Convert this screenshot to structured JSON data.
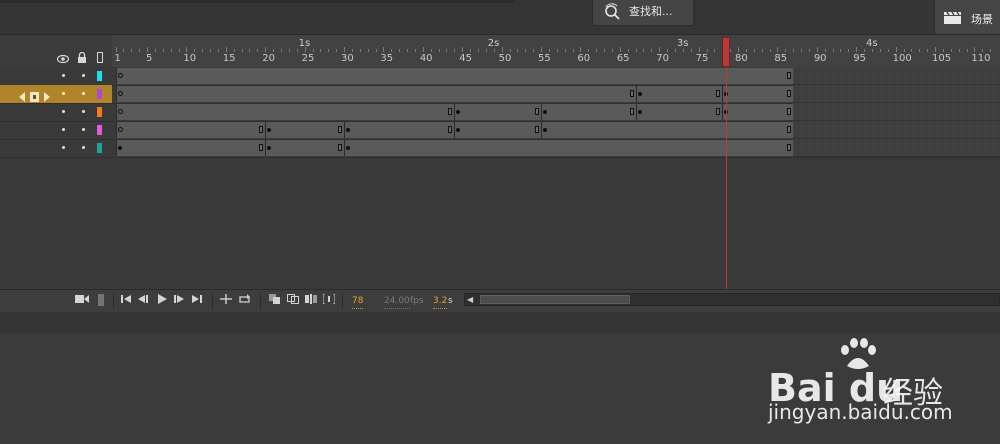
{
  "search": {
    "label": "查找和...",
    "icon": "search-replace-icon"
  },
  "scene": {
    "label": "场景",
    "icon": "clapperboard-icon"
  },
  "ruler": {
    "frame_labels": [
      "1",
      "5",
      "10",
      "15",
      "20",
      "25",
      "30",
      "35",
      "40",
      "45",
      "50",
      "55",
      "60",
      "65",
      "70",
      "75",
      "80",
      "85",
      "90",
      "95",
      "100",
      "105",
      "110"
    ],
    "second_labels": [
      "1s",
      "2s",
      "3s",
      "4s"
    ]
  },
  "header_icons": [
    "eye-icon",
    "lock-icon",
    "outline-icon"
  ],
  "layers": [
    {
      "color": "#1ee0ec",
      "selected": false,
      "spans": [
        [
          1,
          86
        ]
      ],
      "keyframes": [],
      "open_keyframes": [
        1
      ],
      "ends": [
        86
      ]
    },
    {
      "color": "#b04ad6",
      "selected": true,
      "spans": [
        [
          1,
          66
        ],
        [
          67,
          77
        ],
        [
          78,
          86
        ]
      ],
      "keyframes": [
        67,
        78
      ],
      "open_keyframes": [
        1
      ],
      "ends": [
        66,
        77,
        86
      ]
    },
    {
      "color": "#f07c1c",
      "selected": false,
      "spans": [
        [
          1,
          43
        ],
        [
          44,
          54
        ],
        [
          55,
          66
        ],
        [
          67,
          77
        ],
        [
          78,
          86
        ]
      ],
      "keyframes": [
        44,
        55,
        67,
        78
      ],
      "open_keyframes": [
        1
      ],
      "ends": [
        43,
        54,
        66,
        77,
        86
      ]
    },
    {
      "color": "#e05cdc",
      "selected": false,
      "spans": [
        [
          1,
          19
        ],
        [
          20,
          29
        ],
        [
          30,
          43
        ],
        [
          44,
          54
        ],
        [
          55,
          86
        ]
      ],
      "keyframes": [
        20,
        30,
        44,
        55
      ],
      "open_keyframes": [
        1
      ],
      "ends": [
        19,
        29,
        43,
        54,
        86
      ]
    },
    {
      "color": "#1aa79a",
      "selected": false,
      "spans": [
        [
          1,
          19
        ],
        [
          20,
          29
        ],
        [
          30,
          86
        ]
      ],
      "keyframes": [
        1,
        20,
        30
      ],
      "open_keyframes": [],
      "ends": [
        19,
        29,
        86
      ]
    }
  ],
  "playhead_frame": 78,
  "controls": {
    "current_frame": "78",
    "fps": "24.00",
    "fps_unit": "fps",
    "time": "3.2",
    "time_unit": "s"
  },
  "watermark": {
    "logo": "Bai du",
    "cn": "经验",
    "url": "jingyan.baidu.com"
  },
  "colors": {
    "accent": "#e6a32c",
    "playhead": "#c23a3a",
    "selected_row": "#b0852a"
  }
}
